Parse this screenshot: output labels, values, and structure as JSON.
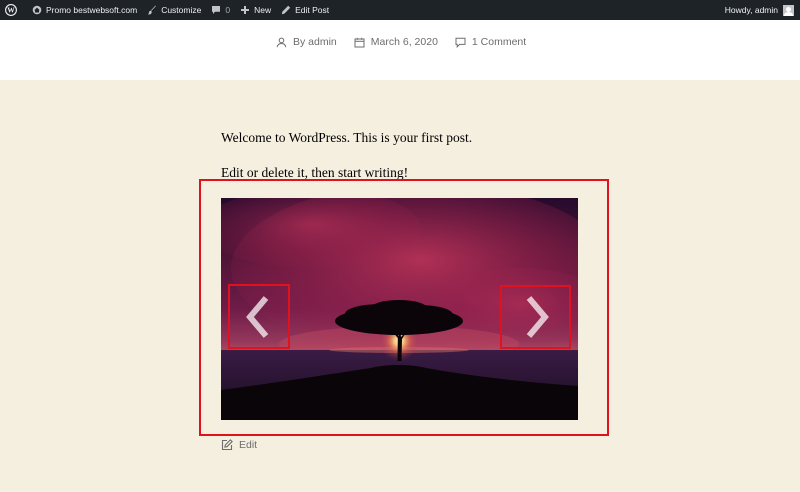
{
  "admin_bar": {
    "site_name": "Promo bestwebsoft.com",
    "customize": "Customize",
    "comments_count": "0",
    "new": "New",
    "edit_post": "Edit Post",
    "greeting": "Howdy, admin",
    "icons": [
      "wordpress-icon",
      "home-icon",
      "brush-icon",
      "comment-bubble-icon",
      "plus-icon",
      "pencil-icon",
      "avatar"
    ]
  },
  "post_meta": {
    "author": "By admin",
    "date": "March 6, 2020",
    "comments": "1 Comment"
  },
  "content": {
    "paragraph_1": "Welcome to WordPress. This is your first post.",
    "paragraph_2": "Edit or delete it, then start writing!"
  },
  "slider": {
    "image": "sunset-tree-photo",
    "prev_icon": "chevron-left-icon",
    "next_icon": "chevron-right-icon"
  },
  "footer": {
    "edit_label": "Edit"
  },
  "colors": {
    "admin_bar_bg": "#1d2327",
    "page_bg": "#f5efe0",
    "header_bg": "#ffffff",
    "highlight": "#e0121e",
    "meta_text": "#6d6d6d"
  }
}
